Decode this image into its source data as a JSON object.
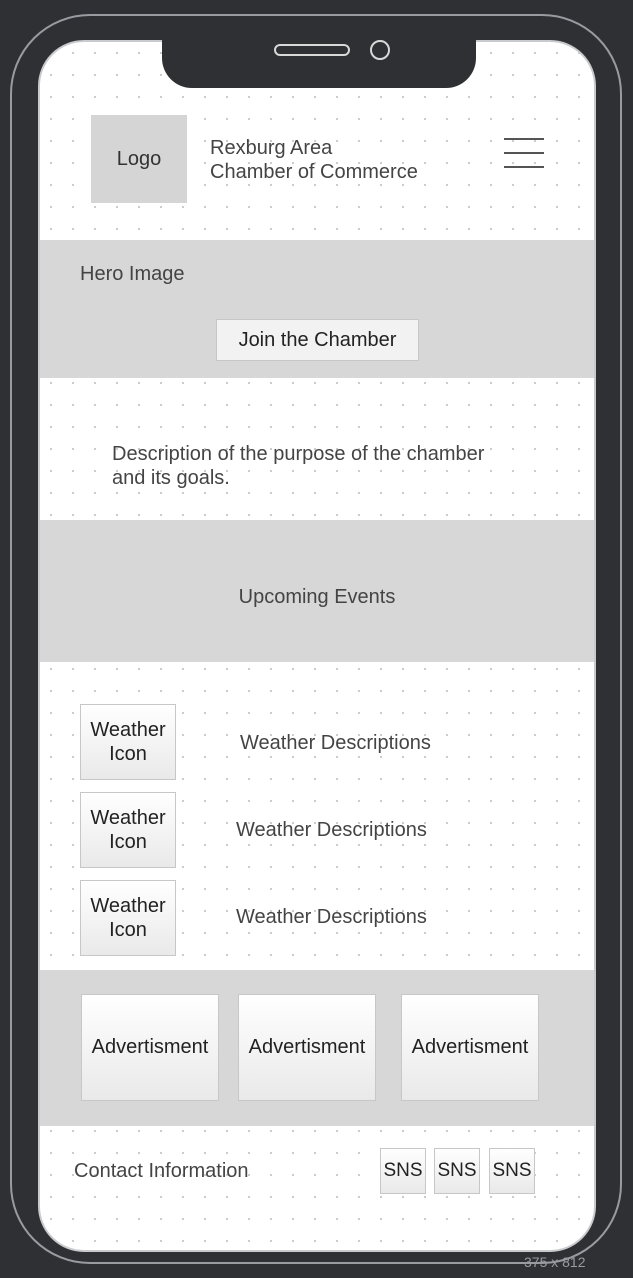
{
  "header": {
    "logo_label": "Logo",
    "title_line1": "Rexburg Area",
    "title_line2": "Chamber of Commerce",
    "menu_icon": "hamburger-menu-icon"
  },
  "hero": {
    "label": "Hero Image",
    "cta_label": "Join the Chamber"
  },
  "description": {
    "line1": "Description of the purpose of the chamber",
    "line2": "and its goals."
  },
  "events": {
    "label": "Upcoming Events"
  },
  "weather": {
    "items": [
      {
        "icon_line1": "Weather",
        "icon_line2": "Icon",
        "description": "Weather Descriptions"
      },
      {
        "icon_line1": "Weather",
        "icon_line2": "Icon",
        "description": "Weather Descriptions"
      },
      {
        "icon_line1": "Weather",
        "icon_line2": "Icon",
        "description": "Weather Descriptions"
      }
    ]
  },
  "ads": {
    "items": [
      "Advertisment",
      "Advertisment",
      "Advertisment"
    ]
  },
  "footer": {
    "contact_label": "Contact Information",
    "sns": [
      "SNS",
      "SNS",
      "SNS"
    ]
  },
  "frame": {
    "size_label": "375 x 812"
  },
  "colors": {
    "device_frame": "#2f3034",
    "section_gray": "#d7d7d7",
    "screen_bg": "#ffffff"
  }
}
